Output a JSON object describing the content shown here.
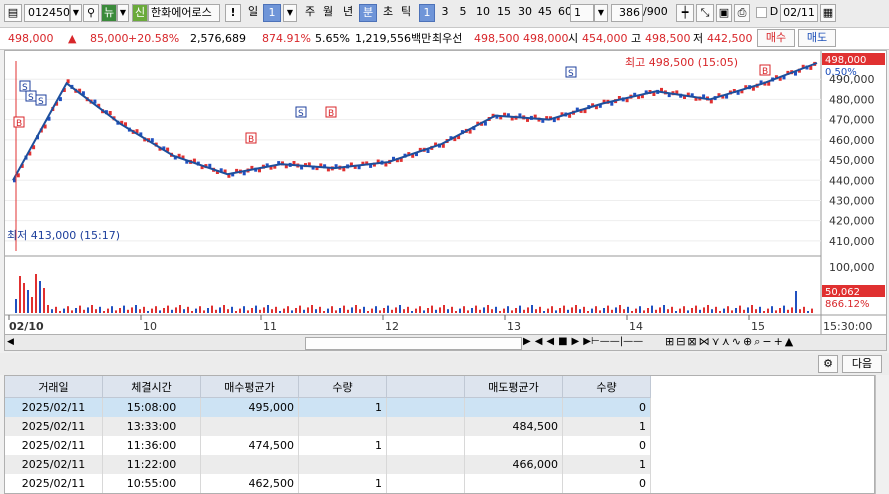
{
  "toolbar": {
    "code": "012450",
    "stock_name": "한화에어로스",
    "periods": [
      "주",
      "월",
      "년",
      "분",
      "초",
      "틱"
    ],
    "day_label": "일",
    "day_value": "1",
    "intervals": [
      "1",
      "3",
      "5",
      "10",
      "15",
      "30",
      "45",
      "60"
    ],
    "interval_value": "1",
    "count": "386",
    "count_total": "/900",
    "date": "02/11",
    "d_label": "D"
  },
  "info": {
    "price": "498,000",
    "arrow": "▲",
    "change": "85,000",
    "change_pct": "+20.58%",
    "volume": "2,576,689",
    "vol_ratio": "874.91%",
    "turnover": "5.65%",
    "amount": "1,219,556백만",
    "best_label": "최우선",
    "best_ask": "498,500",
    "best_bid": "498,000",
    "open_label": "시",
    "open": "454,000",
    "high_label": "고",
    "high": "498,500",
    "low_label": "저",
    "low": "442,500",
    "buy_button": "매수",
    "sell_button": "매도"
  },
  "chart": {
    "high_note": "최고 498,500 (15:05)",
    "low_note": "최저 413,000 (15:17)",
    "price_tag": "498,000",
    "pct_tag": "0.50%",
    "vol_tag": "50,062",
    "vol_pct_tag": "866.12%",
    "y_ticks": [
      "490,000",
      "480,000",
      "470,000",
      "460,000",
      "450,000",
      "440,000",
      "430,000",
      "420,000",
      "410,000"
    ],
    "vol_tick": "100,000",
    "x_labels": [
      "02/10",
      "10",
      "11",
      "12",
      "13",
      "14",
      "15"
    ],
    "time_label": "15:30:00"
  },
  "chart_data": {
    "type": "line",
    "title": "",
    "x": [
      "02/10 09:00",
      "02/10 09:10",
      "02/10 09:20",
      "02/10 09:40",
      "02/10 10:00",
      "02/10 10:30",
      "02/10 11:00",
      "02/10 11:30",
      "02/10 12:00",
      "02/10 12:30",
      "02/10 13:00",
      "02/10 13:30",
      "02/10 14:00",
      "02/10 14:30",
      "02/10 15:00",
      "02/10 15:20"
    ],
    "series": [
      {
        "name": "",
        "values": [
          440000,
          488000,
          468000,
          452000,
          443000,
          448000,
          446000,
          449000,
          458000,
          472000,
          470000,
          478000,
          484000,
          480000,
          488000,
          498000
        ]
      }
    ],
    "ylim": [
      405000,
      500000
    ],
    "markers": {
      "buy": "B",
      "sell": "S"
    }
  },
  "grid_toolbar": {
    "next_button": "다음"
  },
  "table": {
    "columns": [
      "거래일",
      "체결시간",
      "매수평균가",
      "수량",
      "",
      "매도평균가",
      "수량"
    ],
    "rows": [
      [
        "2025/02/11",
        "15:08:00",
        "495,000",
        "1",
        "",
        "",
        "0"
      ],
      [
        "2025/02/11",
        "13:33:00",
        "",
        "",
        "",
        "484,500",
        "1"
      ],
      [
        "2025/02/11",
        "11:36:00",
        "474,500",
        "1",
        "",
        "",
        "0"
      ],
      [
        "2025/02/11",
        "11:22:00",
        "",
        "",
        "",
        "466,000",
        "1"
      ],
      [
        "2025/02/11",
        "10:55:00",
        "462,500",
        "1",
        "",
        "",
        "0"
      ]
    ]
  }
}
